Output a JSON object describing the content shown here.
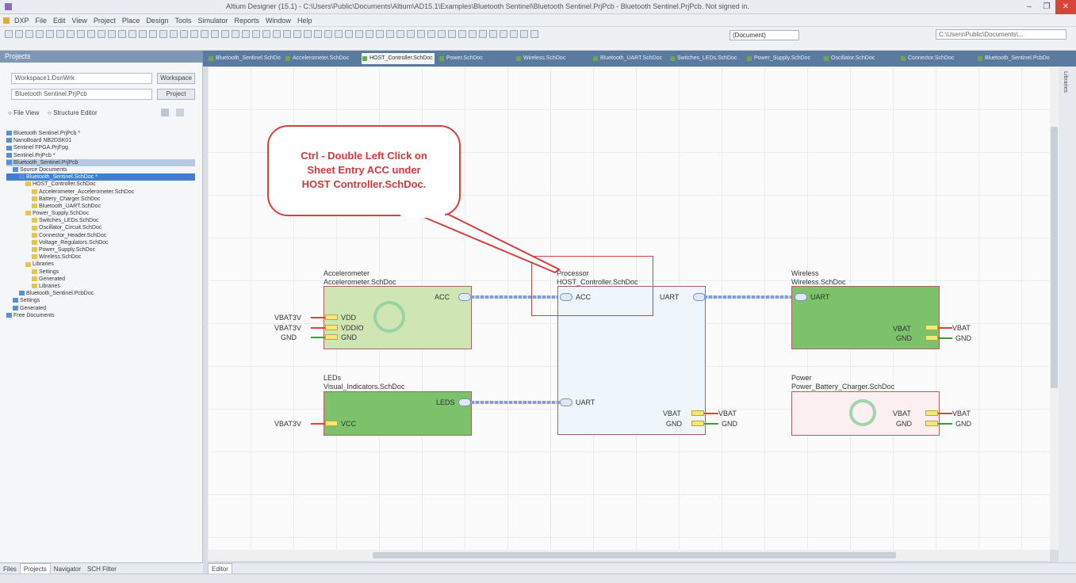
{
  "app": {
    "title": "Altium Designer (15.1) - C:\\Users\\Public\\Documents\\Altium\\AD15.1\\Examples\\Bluetooth Sentinel\\Bluetooth Sentinel.PrjPcb - Bluetooth Sentinel.PrjPcb. Not signed in.",
    "win_min": "–",
    "win_max": "❐",
    "win_close": "✕"
  },
  "menu": [
    "DXP",
    "File",
    "Edit",
    "View",
    "Project",
    "Place",
    "Design",
    "Tools",
    "Simulator",
    "Reports",
    "Window",
    "Help"
  ],
  "toolbar": {
    "doc_select": "(Document)",
    "search": "C:\\Users\\Public\\Documents\\..."
  },
  "projects": {
    "header": "Projects",
    "workspace": "Workspace1.DsnWrk",
    "workspace_btn": "Workspace",
    "project": "Bluetooth Sentinel.PrjPcb",
    "project_btn": "Project",
    "radio_file": "File View",
    "radio_structure": "Structure Editor",
    "tree": [
      {
        "label": "Bluetooth Sentinel.PrjPcb *",
        "indent": 0,
        "state": ""
      },
      {
        "label": "NanoBoard NB2DSK01",
        "indent": 0,
        "state": ""
      },
      {
        "label": "Sentinel FPGA.PrjFpg",
        "indent": 0,
        "state": ""
      },
      {
        "label": "Sentinel.PrjPcb *",
        "indent": 0,
        "state": ""
      },
      {
        "label": "Bluetooth_Sentinel.PrjPcb",
        "indent": 0,
        "state": "sel"
      },
      {
        "label": "Source Documents",
        "indent": 1,
        "state": ""
      },
      {
        "label": "Bluetooth_Sentinel.SchDoc *",
        "indent": 2,
        "state": "sel2"
      },
      {
        "label": "HOST_Controller.SchDoc",
        "indent": 3,
        "state": ""
      },
      {
        "label": "Accelerometer_Accelerometer.SchDoc",
        "indent": 4,
        "state": ""
      },
      {
        "label": "Battery_Charger.SchDoc",
        "indent": 4,
        "state": ""
      },
      {
        "label": "Bluetooth_UART.SchDoc",
        "indent": 4,
        "state": ""
      },
      {
        "label": "Power_Supply.SchDoc",
        "indent": 3,
        "state": ""
      },
      {
        "label": "Switches_LEDs.SchDoc",
        "indent": 4,
        "state": ""
      },
      {
        "label": "Oscillator_Circuit.SchDoc",
        "indent": 4,
        "state": ""
      },
      {
        "label": "Connector_Header.SchDoc",
        "indent": 4,
        "state": ""
      },
      {
        "label": "Voltage_Regulators.SchDoc",
        "indent": 4,
        "state": ""
      },
      {
        "label": "Power_Supply.SchDoc",
        "indent": 4,
        "state": ""
      },
      {
        "label": "Wireless.SchDoc",
        "indent": 4,
        "state": ""
      },
      {
        "label": "Libraries",
        "indent": 3,
        "state": ""
      },
      {
        "label": "Settings",
        "indent": 4,
        "state": ""
      },
      {
        "label": "Generated",
        "indent": 4,
        "state": ""
      },
      {
        "label": "Libraries",
        "indent": 4,
        "state": ""
      },
      {
        "label": "Bluetooth_Sentinel.PcbDoc",
        "indent": 2,
        "state": ""
      },
      {
        "label": "Settings",
        "indent": 1,
        "state": ""
      },
      {
        "label": "Generated",
        "indent": 1,
        "state": ""
      },
      {
        "label": "Free Documents",
        "indent": 0,
        "state": ""
      }
    ],
    "bottom_tabs": [
      "Files",
      "Projects",
      "Navigator",
      "SCH Filter"
    ]
  },
  "doc_tabs": [
    "Bluetooth_Sentinel.SchDoc",
    "Accelerometer.SchDoc",
    "HOST_Controller.SchDoc",
    "Power.SchDoc",
    "Wireless.SchDoc",
    "Bluetooth_UART.SchDoc",
    "Switches_LEDs.SchDoc",
    "Power_Supply.SchDoc",
    "Oscillator.SchDoc",
    "Connector.SchDoc",
    "Bluetooth_Sentinel.PcbDoc"
  ],
  "canvas_status": "Editor",
  "right_strip": "Libraries",
  "callout": {
    "line1": "Ctrl - Double Left Click on",
    "line2": "Sheet Entry ACC under",
    "line3": "HOST Controller.SchDoc."
  },
  "sheets": {
    "accel": {
      "title": "Accelerometer",
      "file": "Accelerometer.SchDoc",
      "port_acc": "ACC",
      "pins": [
        "VDD",
        "VDDIO",
        "GND"
      ],
      "ext": [
        "VBAT3V",
        "VBAT3V",
        "GND"
      ]
    },
    "host": {
      "title": "Processor",
      "file": "HOST_Controller.SchDoc",
      "port_acc": "ACC",
      "port_uart": "UART",
      "port_uart2": "UART",
      "pins": [
        "VBAT",
        "GND"
      ],
      "ext": [
        "VBAT",
        "GND"
      ]
    },
    "wireless": {
      "title": "Wireless",
      "file": "Wireless.SchDoc",
      "port": "UART",
      "pins": [
        "VBAT",
        "GND"
      ],
      "ext": [
        "VBAT",
        "GND"
      ]
    },
    "leds": {
      "title": "LEDs",
      "file": "Visual_Indicators.SchDoc",
      "port": "LEDS",
      "pins": [
        "VCC"
      ],
      "ext": [
        "VBAT3V"
      ]
    },
    "power": {
      "title": "Power",
      "file": "Power_Battery_Charger.SchDoc",
      "pins": [
        "VBAT",
        "GND"
      ],
      "ext": [
        "VBAT",
        "GND"
      ]
    }
  },
  "colors": {
    "sheet_green": "#7cc26a",
    "sheet_lightgreen": "#cfe6b4",
    "sheet_blue": "#eef5fb",
    "sheet_pink": "#fbeff2",
    "callout_red": "#d44040"
  }
}
